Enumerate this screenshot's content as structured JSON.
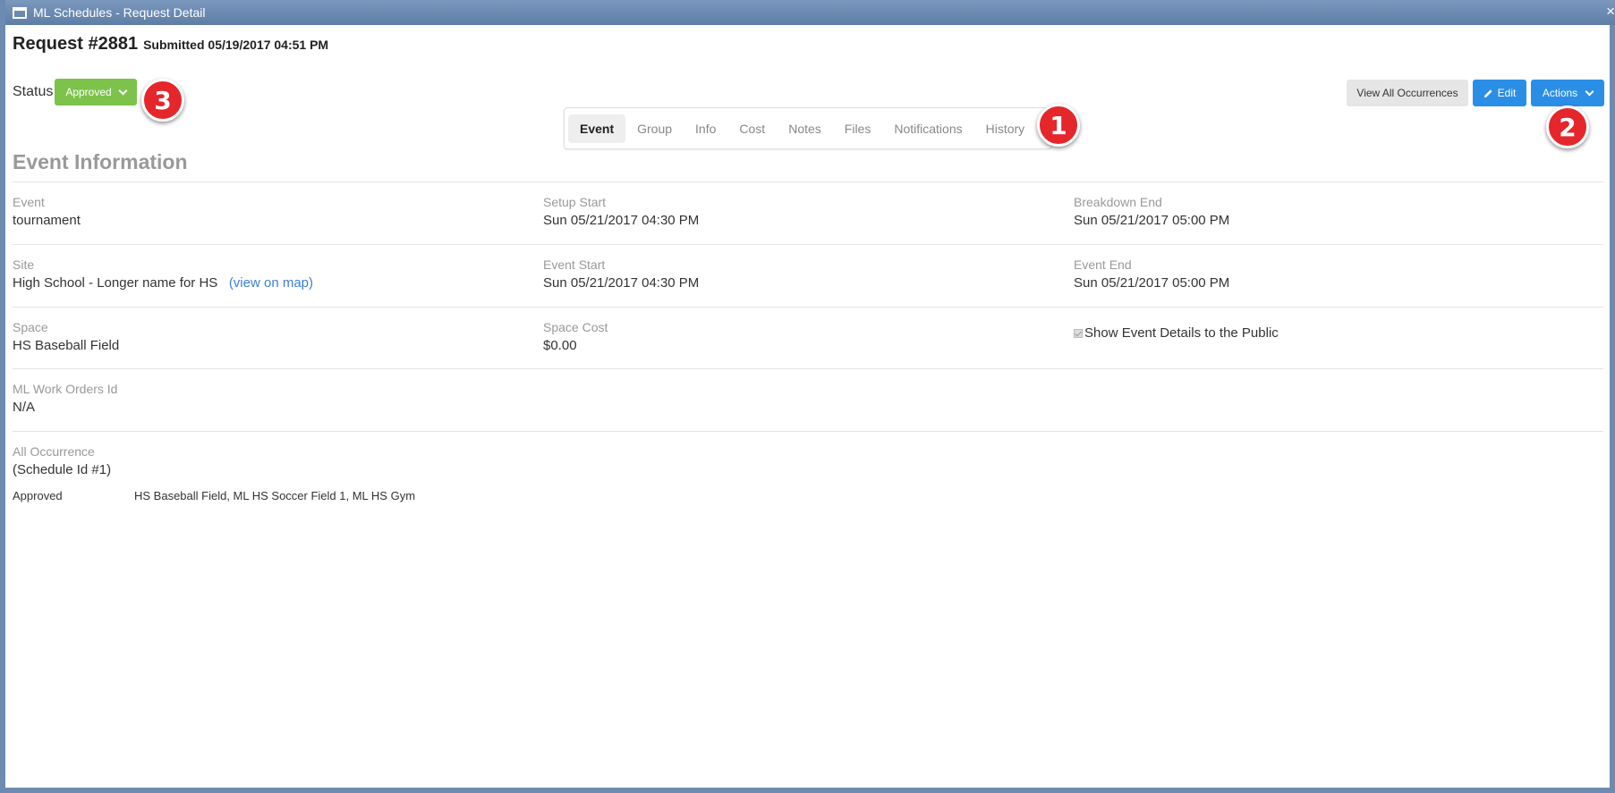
{
  "window": {
    "title": "ML Schedules - Request Detail",
    "close_glyph": "×"
  },
  "header": {
    "request_title": "Request #2881",
    "submitted": "Submitted 05/19/2017 04:51 PM"
  },
  "status": {
    "label": "Status",
    "value": "Approved",
    "color": "#7dc34b"
  },
  "tabs": [
    {
      "label": "Event",
      "active": true
    },
    {
      "label": "Group"
    },
    {
      "label": "Info"
    },
    {
      "label": "Cost"
    },
    {
      "label": "Notes"
    },
    {
      "label": "Files"
    },
    {
      "label": "Notifications"
    },
    {
      "label": "History"
    }
  ],
  "toolbar": {
    "view_all_label": "View All Occurrences",
    "edit_label": "Edit",
    "actions_label": "Actions",
    "primary_color": "#2b8ee6"
  },
  "callouts": [
    "1",
    "2",
    "3"
  ],
  "section": {
    "title": "Event Information"
  },
  "fields": {
    "event": {
      "label": "Event",
      "value": "tournament"
    },
    "setup_start": {
      "label": "Setup Start",
      "value": "Sun 05/21/2017 04:30 PM"
    },
    "breakdown_end": {
      "label": "Breakdown End",
      "value": "Sun 05/21/2017 05:00 PM"
    },
    "site": {
      "label": "Site",
      "value": "High School - Longer name for HS",
      "link": "(view on map)"
    },
    "event_start": {
      "label": "Event Start",
      "value": "Sun 05/21/2017 04:30 PM"
    },
    "event_end": {
      "label": "Event End",
      "value": "Sun 05/21/2017 05:00 PM"
    },
    "space": {
      "label": "Space",
      "value": "HS Baseball Field"
    },
    "space_cost": {
      "label": "Space Cost",
      "value": "$0.00"
    },
    "show_public": {
      "label": "Show Event Details to the Public",
      "checked": true
    },
    "work_orders": {
      "label": "ML Work Orders Id",
      "value": "N/A"
    },
    "all_occurrence": {
      "label": "All Occurrence",
      "link": "(Schedule Id #1)"
    }
  },
  "occurrences": [
    {
      "status": "Approved",
      "spaces": "HS Baseball Field, ML HS Soccer Field 1, ML HS Gym"
    }
  ]
}
